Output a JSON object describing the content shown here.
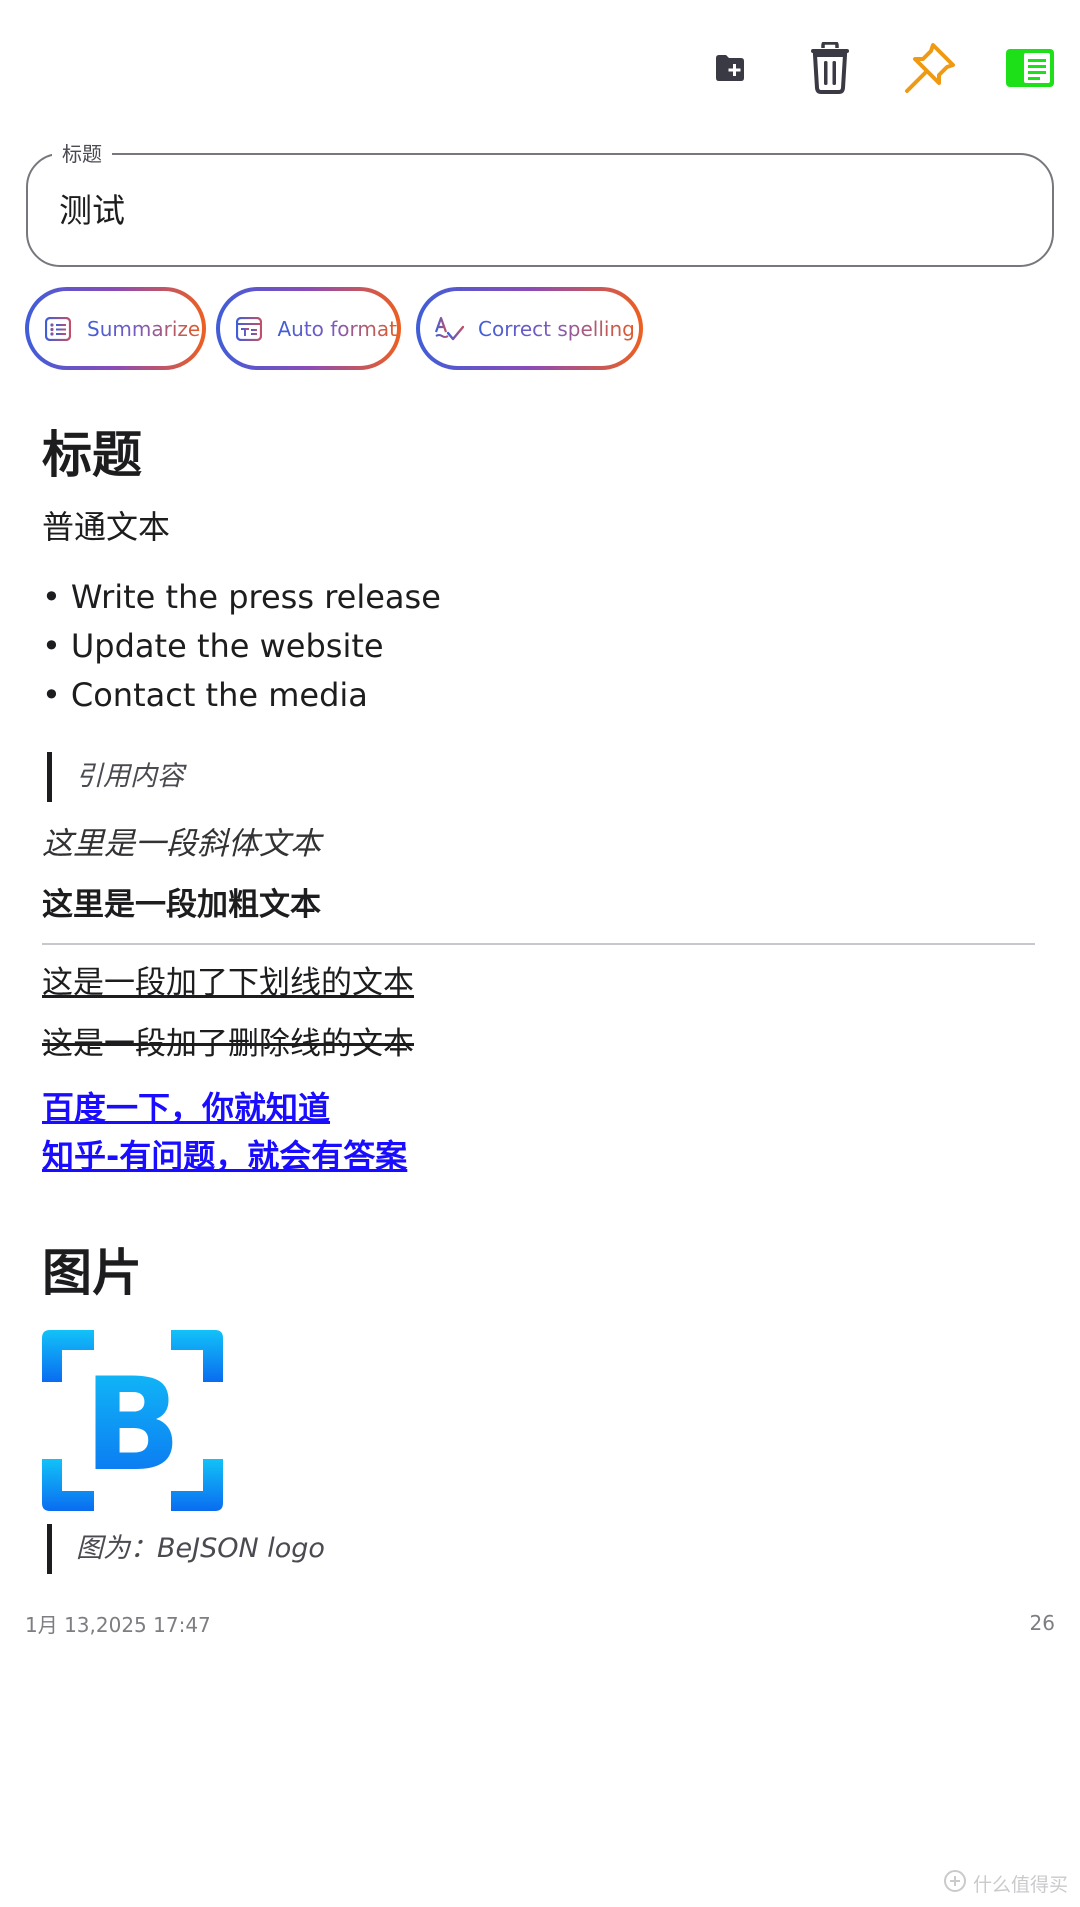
{
  "toolbar": {
    "icons": [
      "folder-add-icon",
      "trash-icon",
      "pin-icon",
      "reader-mode-icon"
    ],
    "colors": {
      "folder": "#3a3a44",
      "trash": "#3a3a44",
      "pin": "#ef9a12",
      "reader": "#1ee018"
    }
  },
  "title_field": {
    "label": "标题",
    "value": "测试"
  },
  "ai_actions": [
    {
      "label": "Summarize",
      "icon": "list-icon"
    },
    {
      "label": "Auto format",
      "icon": "format-icon"
    },
    {
      "label": "Correct spelling",
      "icon": "spellcheck-icon"
    }
  ],
  "note": {
    "heading1": "标题",
    "paragraph": "普通文本",
    "bullets": [
      "Write the press release",
      "Update the website",
      "Contact the media"
    ],
    "quote": "引用内容",
    "italic_text": "这里是一段斜体文本",
    "bold_text": "这里是一段加粗文本",
    "underline_text": "这是一段加了下划线的文本",
    "strike_text": "这是一段加了删除线的文本",
    "links": [
      "百度一下，你就知道",
      "知乎-有问题，就会有答案"
    ],
    "heading2": "图片",
    "image_logo_text": "B",
    "image_caption": "图为：BeJSON logo"
  },
  "footer": {
    "datetime": "1月 13,2025 17:47",
    "char_count": "26"
  },
  "watermark": {
    "text": "什么值得买"
  },
  "colors": {
    "link": "#1a0dff",
    "chip_gradient_start": "#3f5ed8",
    "chip_gradient_end": "#ef5f1f",
    "logo_gradient_top": "#12c2f8",
    "logo_gradient_bottom": "#0a6cf0"
  }
}
